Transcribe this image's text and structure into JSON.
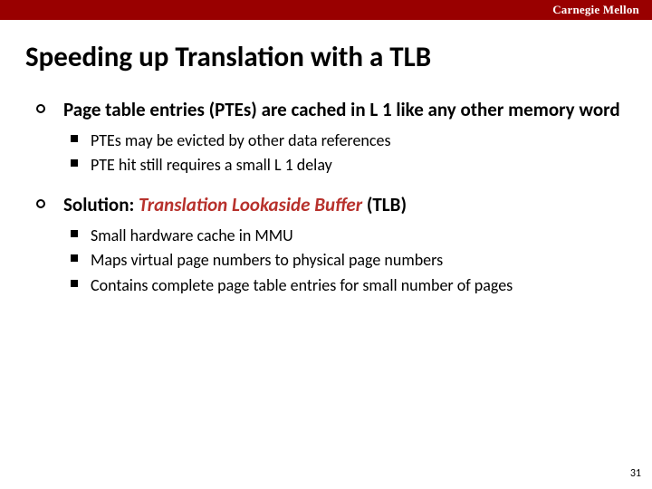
{
  "header": {
    "university": "Carnegie Mellon"
  },
  "title": "Speeding up Translation with a TLB",
  "bullets": [
    {
      "text": "Page table entries (PTEs) are cached in L 1 like any other memory word",
      "sub": [
        "PTEs may be evicted by other data references",
        "PTE hit still requires a small L 1 delay"
      ]
    },
    {
      "prefix": "Solution: ",
      "emph": "Translation Lookaside Buffer",
      "suffix": " (TLB)",
      "sub": [
        "Small hardware cache in MMU",
        "Maps virtual page numbers to  physical page numbers",
        "Contains complete page table entries for small number of pages"
      ]
    }
  ],
  "page_number": "31"
}
